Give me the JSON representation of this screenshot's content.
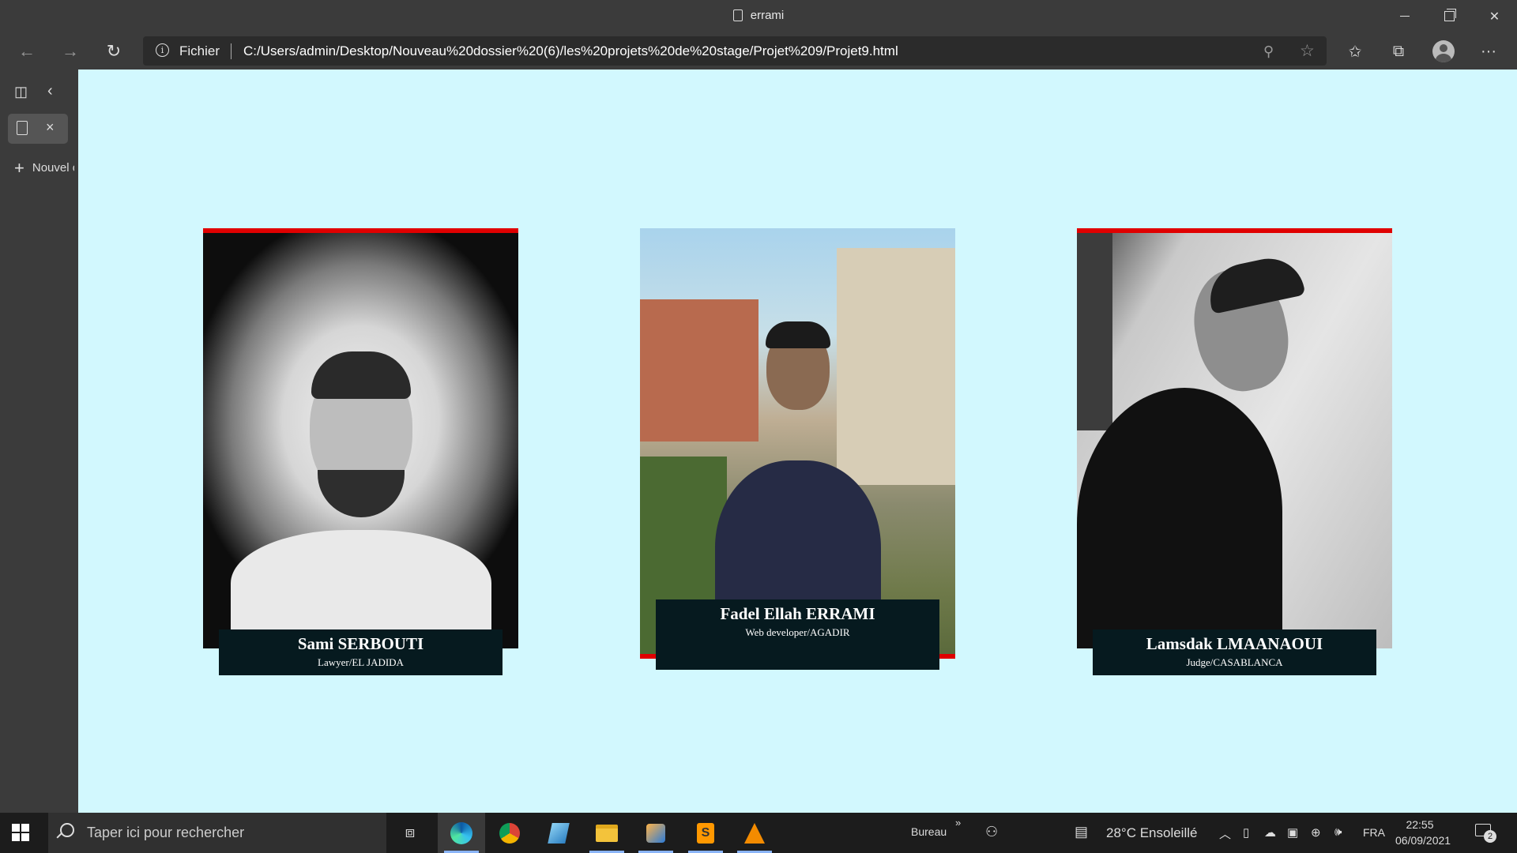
{
  "window": {
    "title": "errami",
    "controls": {
      "minimize": "–",
      "maximize": "",
      "close": "✕"
    }
  },
  "toolbar": {
    "back_icon": "arrow-left-icon",
    "forward_icon": "arrow-right-icon",
    "refresh_icon": "refresh-icon",
    "site_info_label": "Fichier",
    "url": "C:/Users/admin/Desktop/Nouveau%20dossier%20(6)/les%20projets%20de%20stage/Projet%209/Projet9.html"
  },
  "sidebar": {
    "new_tab_label": "Nouvel onglet"
  },
  "page": {
    "cards": [
      {
        "name": "Sami SERBOUTI",
        "role": "Lawyer/EL JADIDA"
      },
      {
        "name": "Fadel Ellah ERRAMI",
        "role": "Web developer/AGADIR"
      },
      {
        "name": "Lamsdak LMAANAOUI",
        "role": "Judge/CASABLANCA"
      }
    ],
    "accent_color": "#e00000",
    "background_color": "#d2f8fe",
    "nameplate_color": "#061a1f"
  },
  "taskbar": {
    "search_placeholder": "Taper ici pour rechercher",
    "desktop_label": "Bureau",
    "more_label": "»",
    "weather": "28°C  Ensoleillé",
    "language": "FRA",
    "time": "22:55",
    "date": "06/09/2021",
    "notification_count": "2"
  }
}
